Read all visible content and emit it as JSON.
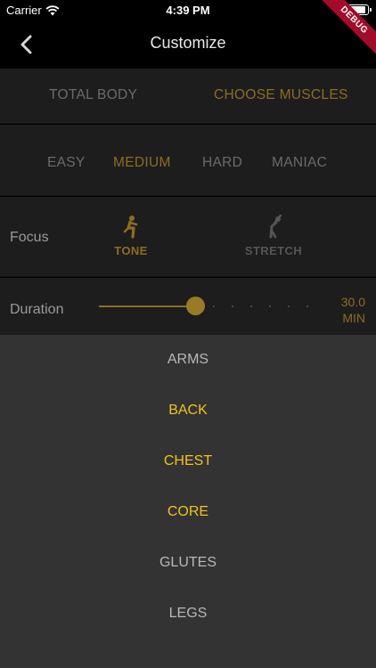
{
  "status_bar": {
    "carrier": "Carrier",
    "time": "4:39 PM"
  },
  "debug_banner": "DEBUG",
  "nav": {
    "title": "Customize",
    "back_icon": "chevron-left-icon"
  },
  "mode_tabs": [
    {
      "label": "TOTAL BODY",
      "selected": false
    },
    {
      "label": "CHOOSE MUSCLES",
      "selected": true
    }
  ],
  "difficulty": [
    {
      "label": "EASY",
      "selected": false
    },
    {
      "label": "MEDIUM",
      "selected": true
    },
    {
      "label": "HARD",
      "selected": false
    },
    {
      "label": "MANIAC",
      "selected": false
    }
  ],
  "focus": {
    "label": "Focus",
    "options": [
      {
        "label": "TONE",
        "icon": "squat-figure-icon",
        "selected": true
      },
      {
        "label": "STRETCH",
        "icon": "stretch-figure-icon",
        "selected": false
      }
    ]
  },
  "duration": {
    "label": "Duration",
    "value_line1": "30.0",
    "value_line2": "MIN",
    "slider_fraction": 0.45
  },
  "muscles": [
    {
      "label": "ARMS",
      "selected": false
    },
    {
      "label": "BACK",
      "selected": true
    },
    {
      "label": "CHEST",
      "selected": true
    },
    {
      "label": "CORE",
      "selected": true
    },
    {
      "label": "GLUTES",
      "selected": false
    },
    {
      "label": "LEGS",
      "selected": false
    }
  ],
  "colors": {
    "accent_gold": "#8c6d22",
    "selected_yellow": "#f2c21b",
    "panel_bg": "#1d1d1d",
    "list_bg": "#333333"
  }
}
